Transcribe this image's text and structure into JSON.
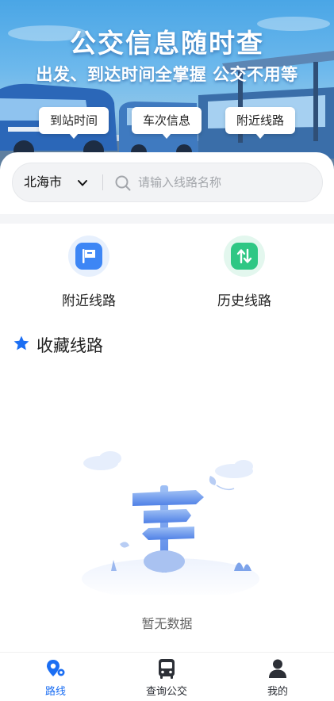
{
  "banner": {
    "title": "公交信息随时查",
    "subtitle": "出发、到达时间全掌握 公交不用等",
    "chips": [
      "到站时间",
      "车次信息",
      "附近线路"
    ]
  },
  "search": {
    "city": "北海市",
    "placeholder": "请输入线路名称"
  },
  "shortcuts": [
    {
      "label": "附近线路",
      "icon": "flag-icon",
      "color": "#3d86f5"
    },
    {
      "label": "历史线路",
      "icon": "swap-arrows-icon",
      "color": "#2fc784"
    }
  ],
  "favorites": {
    "title": "收藏线路",
    "empty_text": "暂无数据"
  },
  "bottom_nav": [
    {
      "label": "路线",
      "icon": "route-pin-icon",
      "active": true
    },
    {
      "label": "查询公交",
      "icon": "bus-icon",
      "active": false
    },
    {
      "label": "我的",
      "icon": "user-icon",
      "active": false
    }
  ],
  "colors": {
    "accent": "#1b6ef3",
    "nearby_tile": "#3d86f5",
    "history_tile": "#2fc784",
    "star": "#1b6ef3"
  }
}
